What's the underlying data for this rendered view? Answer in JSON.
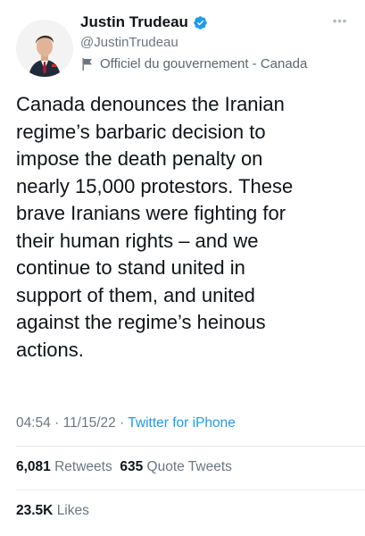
{
  "author": {
    "display_name": "Justin Trudeau",
    "handle": "@JustinTrudeau",
    "label": "Officiel du gouvernement - Canada",
    "avatar_icon": "person-portrait-icon",
    "verified_icon": "verified-badge-icon",
    "flag_icon": "flag-icon",
    "more_icon": "more-options-icon"
  },
  "tweet": {
    "text": "Canada denounces the Iranian\nregime’s barbaric decision to\nimpose the death penalty on\nnearly 15,000 protestors. These\nbrave Iranians were fighting for\ntheir human rights – and we\ncontinue to stand united in\nsupport of them, and united\nagainst the regime’s heinous\nactions."
  },
  "meta": {
    "time": "04:54",
    "date": "11/15/22",
    "separator": "·",
    "source": "Twitter for iPhone"
  },
  "stats": {
    "retweets_count": "6,081",
    "retweets_label": "Retweets",
    "quotes_count": "635",
    "quotes_label": "Quote Tweets",
    "likes_count": "23.5K",
    "likes_label": "Likes"
  },
  "colors": {
    "text": "#0f1419",
    "secondary": "#6b7680",
    "link": "#1d9bf0",
    "verified": "#1d9bf0",
    "divider": "#e7eaec"
  }
}
